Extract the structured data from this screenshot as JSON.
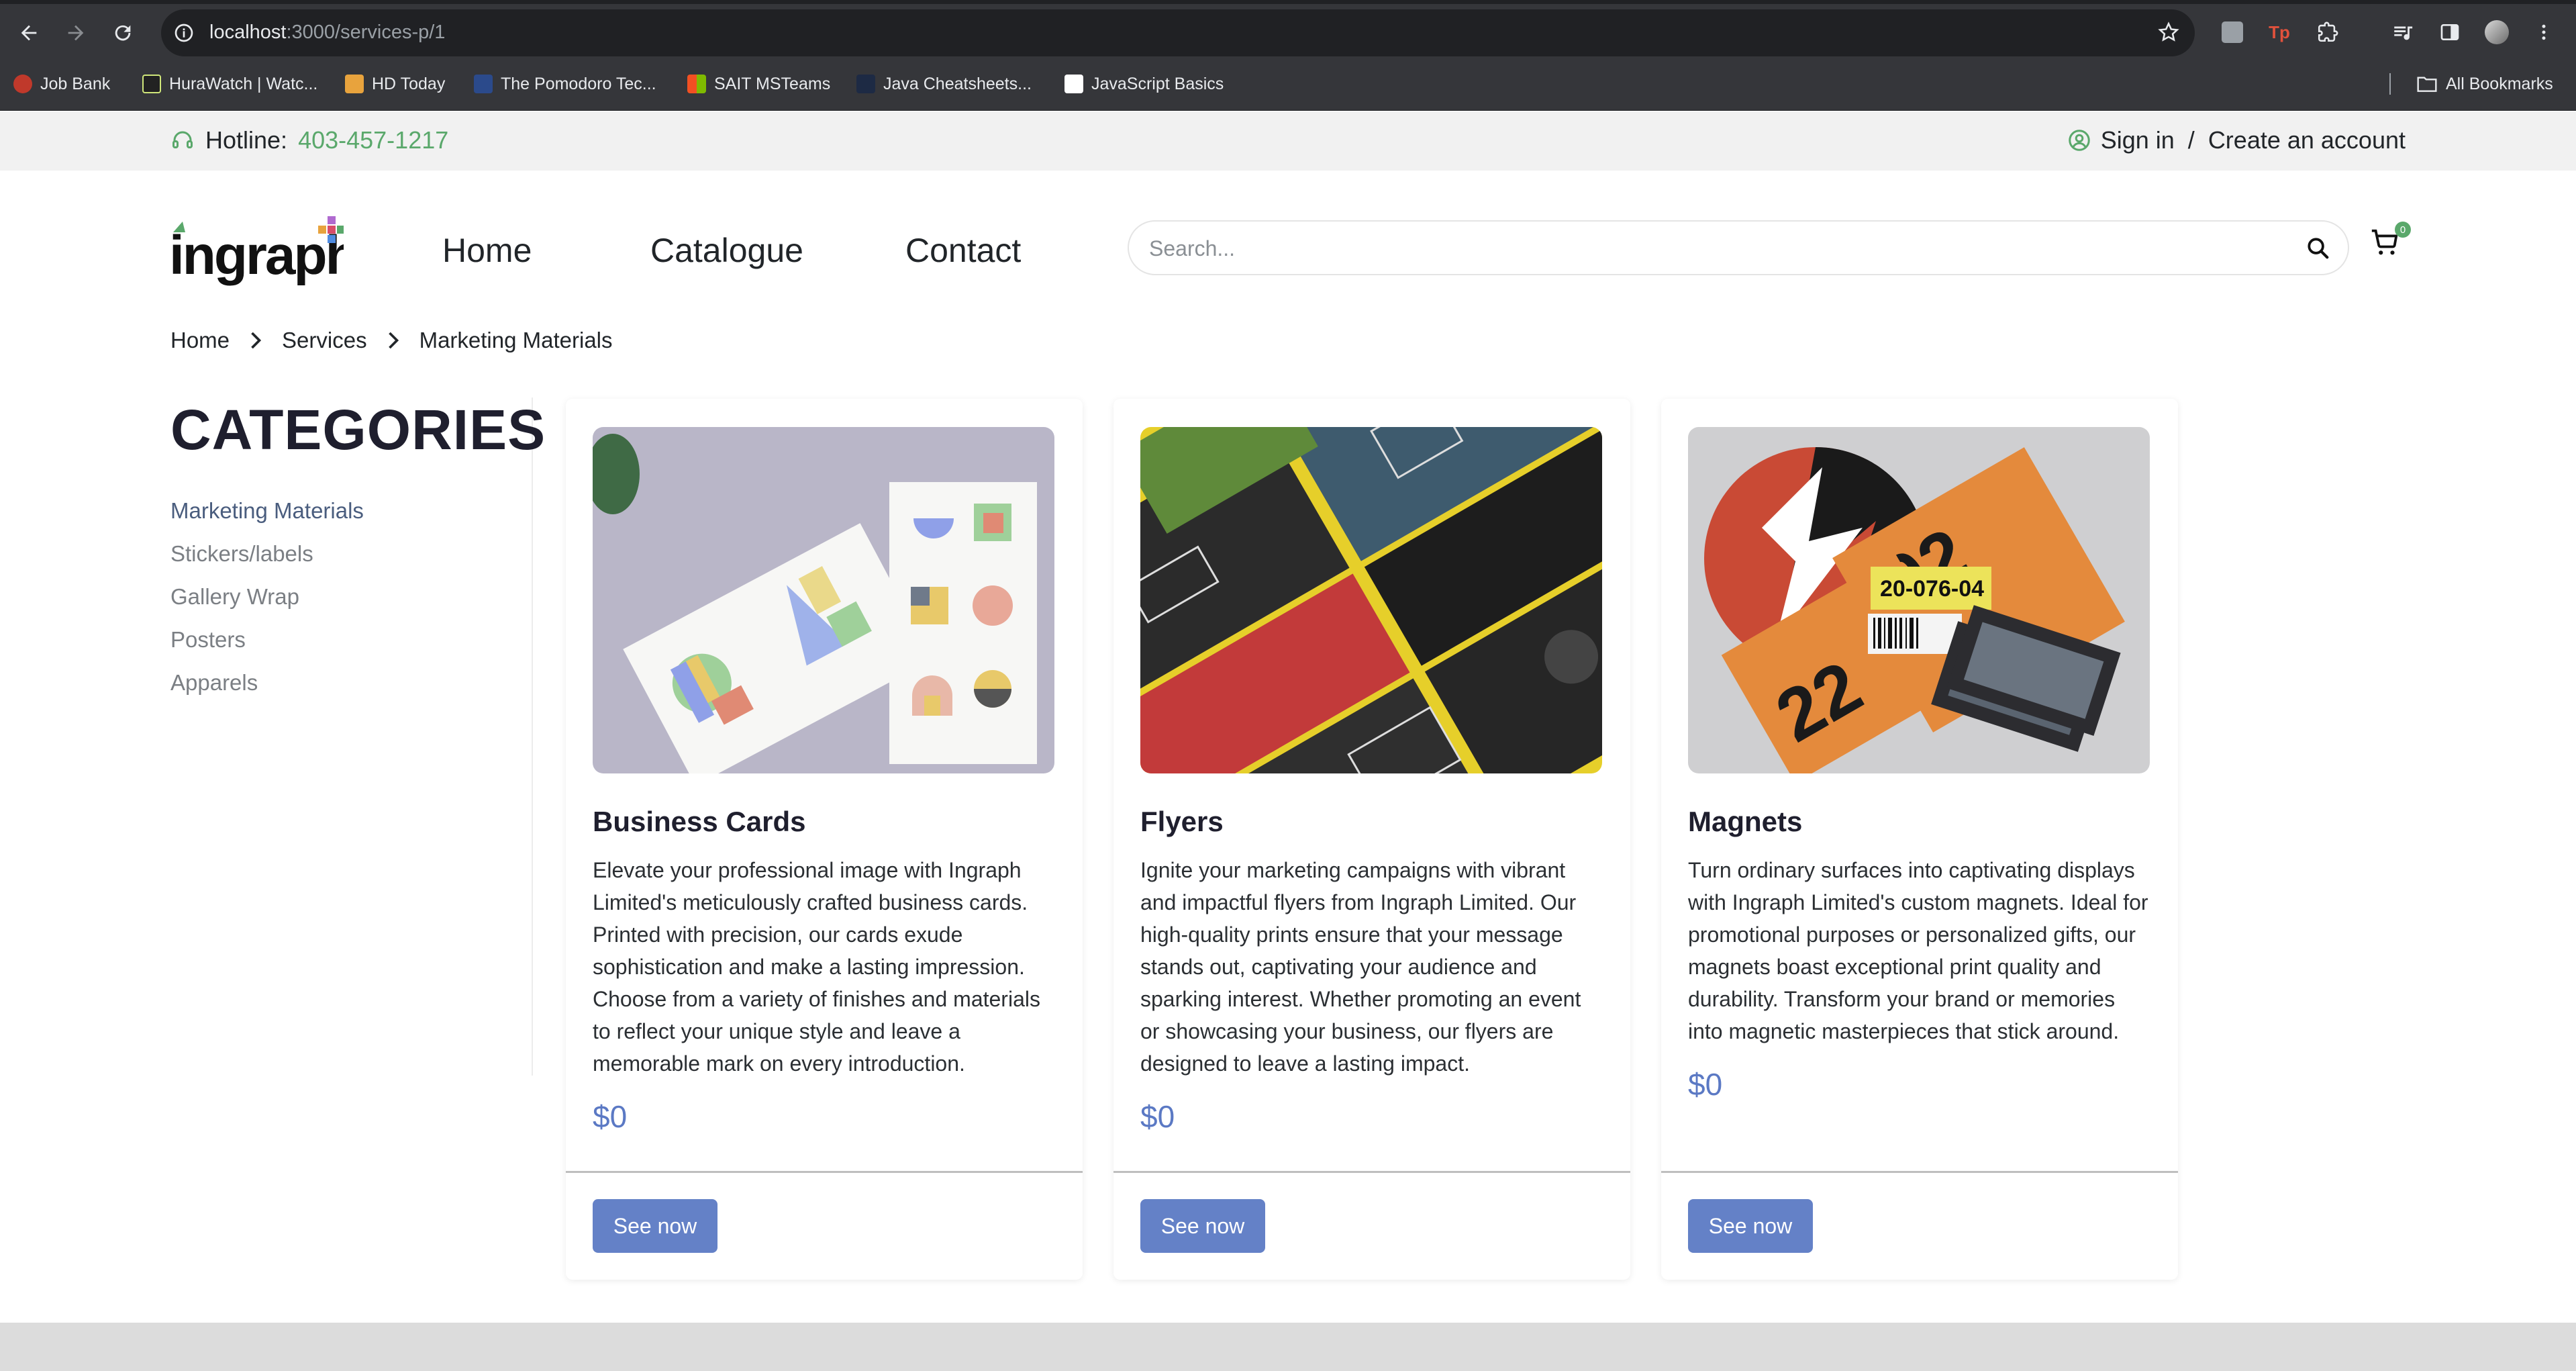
{
  "browser": {
    "url_host": "localhost",
    "url_rest": ":3000/services-p/1",
    "bookmarks": [
      {
        "label": "Job Bank",
        "color": "#c0392b"
      },
      {
        "label": "HuraWatch | Watc...",
        "color": "#222222"
      },
      {
        "label": "HD Today",
        "color": "#e8a33d"
      },
      {
        "label": "The Pomodoro Tec...",
        "color": "#2b4a8b"
      },
      {
        "label": "SAIT MSTeams",
        "color": "#4f8be0"
      },
      {
        "label": "Java Cheatsheets...",
        "color": "#1d2a44"
      },
      {
        "label": "JavaScript Basics",
        "color": "#ffffff"
      }
    ],
    "all_bookmarks": "All Bookmarks"
  },
  "topbar": {
    "hotline_label": "Hotline:",
    "hotline_number": "403-457-1217",
    "sign_in": "Sign in",
    "separator": "/",
    "create_account": "Create an account"
  },
  "header": {
    "logo_text": "ingraph",
    "nav": [
      "Home",
      "Catalogue",
      "Contact"
    ],
    "search_placeholder": "Search...",
    "cart_count": "0"
  },
  "breadcrumb": [
    "Home",
    "Services",
    "Marketing Materials"
  ],
  "sidebar": {
    "title": "CATEGORIES",
    "items": [
      "Marketing Materials",
      "Stickers/labels",
      "Gallery Wrap",
      "Posters",
      "Apparels"
    ]
  },
  "cards": [
    {
      "title": "Business Cards",
      "description": "Elevate your professional image with Ingraph Limited's meticulously crafted business cards. Printed with precision, our cards exude sophistication and make a lasting impression. Choose from a variety of finishes and materials to reflect your unique style and leave a memorable mark on every introduction.",
      "price": "$0",
      "button": "See now"
    },
    {
      "title": "Flyers",
      "description": "Ignite your marketing campaigns with vibrant and impactful flyers from Ingraph Limited. Our high-quality prints ensure that your message stands out, captivating your audience and sparking interest. Whether promoting an event or showcasing your business, our flyers are designed to leave a lasting impact.",
      "price": "$0",
      "button": "See now"
    },
    {
      "title": "Magnets",
      "description": "Turn ordinary surfaces into captivating displays with Ingraph Limited's custom magnets. Ideal for promotional purposes or personalized gifts, our magnets boast exceptional print quality and durability. Transform your brand or memories into magnetic masterpieces that stick around.",
      "price": "$0",
      "button": "See now",
      "image_text_1": "20-076-04",
      "image_text_2": "02",
      "image_text_3": "22"
    }
  ],
  "colors": {
    "accent_green": "#5aa86b",
    "button_blue": "#6481c7",
    "price_blue": "#5b79c4"
  }
}
